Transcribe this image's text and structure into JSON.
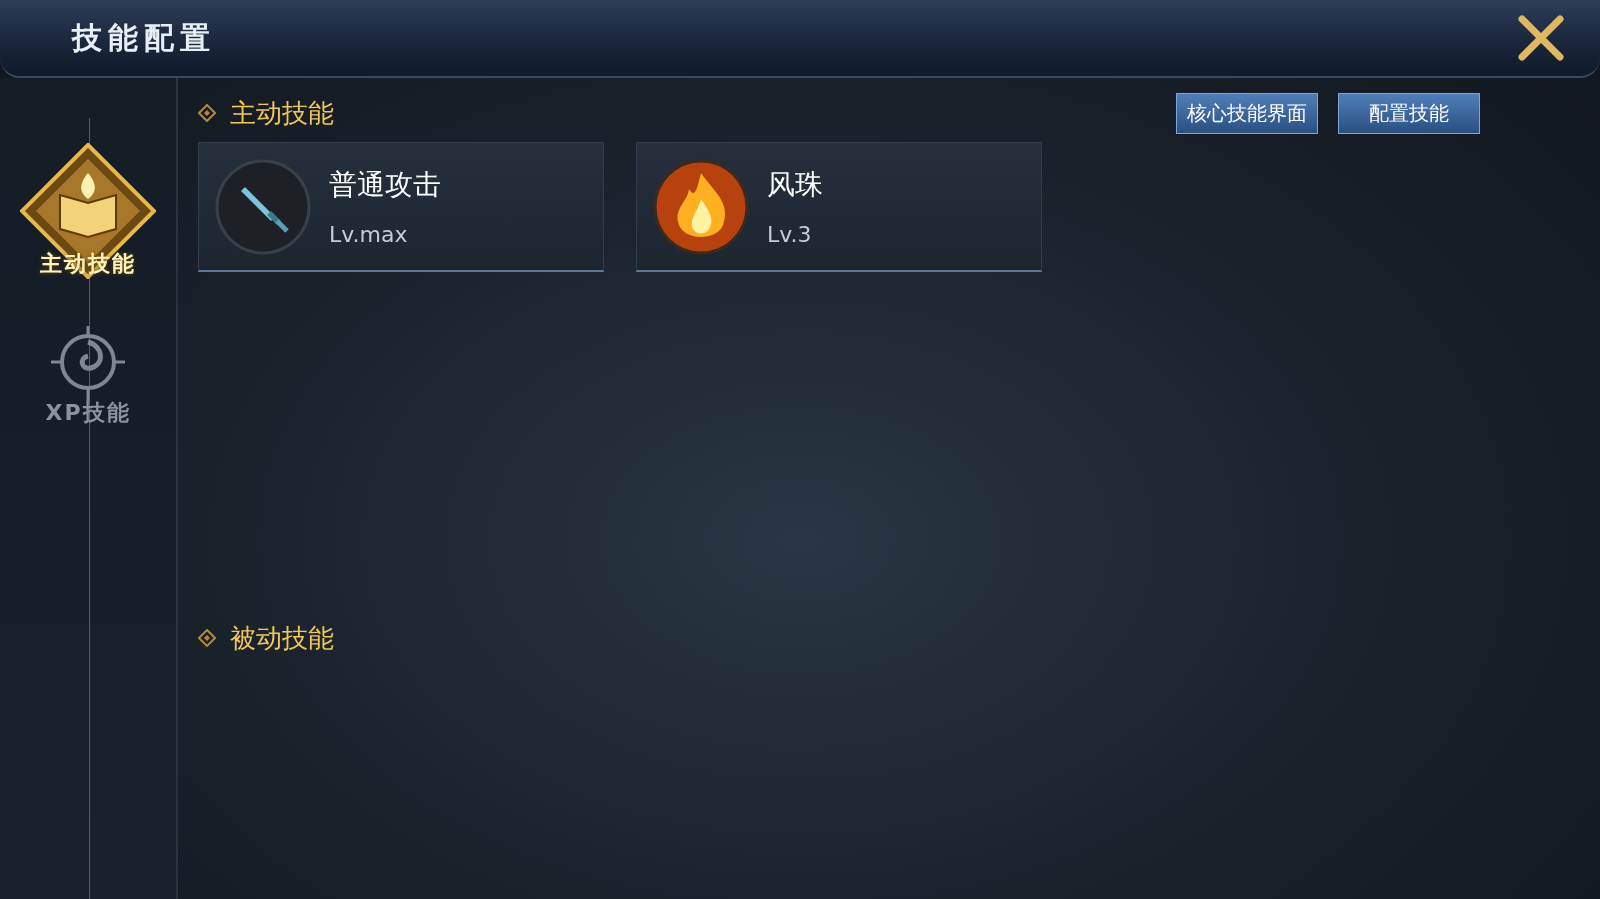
{
  "window": {
    "title": "技能配置"
  },
  "sidebar": {
    "tabs": [
      {
        "label": "主动技能",
        "kind": "book",
        "selected": true
      },
      {
        "label": "XP技能",
        "kind": "swirl",
        "selected": false
      }
    ]
  },
  "active_section": {
    "title": "主动技能",
    "buttons": [
      "核心技能界面",
      "配置技能"
    ],
    "skills": [
      {
        "name": "普通攻击",
        "level": "Lv.max",
        "kind": "sword"
      },
      {
        "name": "风珠",
        "level": "Lv.3",
        "kind": "fire"
      }
    ]
  },
  "passive_section": {
    "title": "被动技能"
  }
}
